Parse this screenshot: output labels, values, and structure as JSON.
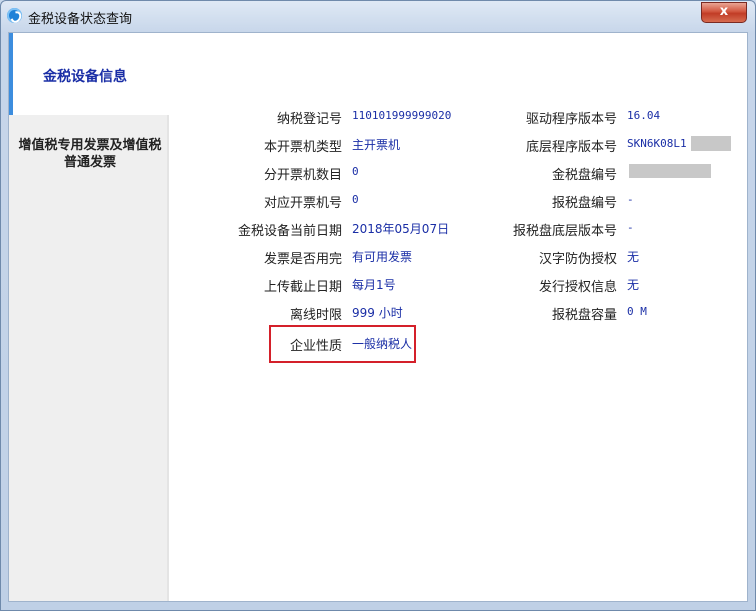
{
  "window": {
    "title": "金税设备状态查询",
    "close_label": "x"
  },
  "sidebar": {
    "items": [
      {
        "label": "金税设备信息",
        "active": true
      },
      {
        "label": "增值税专用发票及增值税普通发票",
        "active": false
      }
    ]
  },
  "left_fields": [
    {
      "label": "纳税登记号",
      "value": "110101999999020"
    },
    {
      "label": "本开票机类型",
      "value": "主开票机"
    },
    {
      "label": "分开票机数目",
      "value": "0"
    },
    {
      "label": "对应开票机号",
      "value": "0"
    },
    {
      "label": "金税设备当前日期",
      "value": "2018年05月07日"
    },
    {
      "label": "发票是否用完",
      "value": "有可用发票"
    },
    {
      "label": "上传截止日期",
      "value": "每月1号"
    },
    {
      "label": "离线时限",
      "value": "999 小时"
    },
    {
      "label": "企业性质",
      "value": "一般纳税人"
    }
  ],
  "right_fields": [
    {
      "label": "驱动程序版本号",
      "value": "16.04"
    },
    {
      "label": "底层程序版本号",
      "value": "SKN6K08L1"
    },
    {
      "label": "金税盘编号",
      "value": ""
    },
    {
      "label": "报税盘编号",
      "value": "-"
    },
    {
      "label": "报税盘底层版本号",
      "value": "-"
    },
    {
      "label": "汉字防伪授权",
      "value": "无"
    },
    {
      "label": "发行授权信息",
      "value": "无"
    },
    {
      "label": "报税盘容量",
      "value": "0 M"
    }
  ],
  "colors": {
    "value_text": "#1a2ea6",
    "highlight_border": "#d4202a",
    "active_tab_accent": "#3c8dde"
  }
}
